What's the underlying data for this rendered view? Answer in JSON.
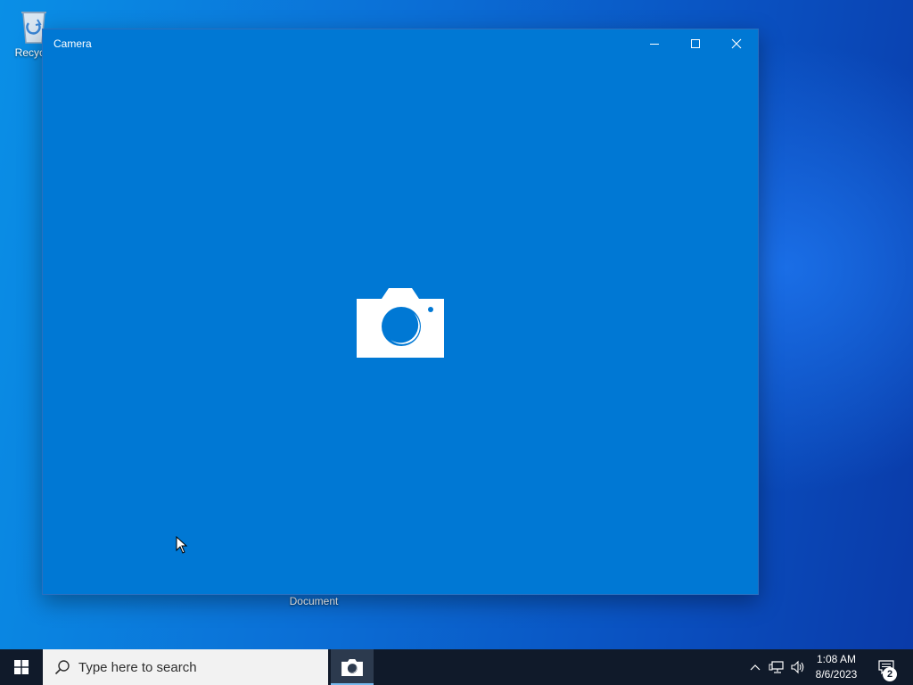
{
  "desktop": {
    "icons": [
      {
        "label": "Recycle",
        "icon": "recycle-bin-icon"
      },
      {
        "label": "Document",
        "icon": "document-icon"
      }
    ]
  },
  "window": {
    "title": "Camera",
    "controls": {
      "minimize": "minimize-icon",
      "maximize": "maximize-icon",
      "close": "close-icon"
    },
    "center_icon": "camera-icon",
    "background": "#0078d4"
  },
  "taskbar": {
    "search_placeholder": "Type here to search",
    "pinned_app": "camera-icon",
    "tray": {
      "time": "1:08 AM",
      "date": "8/6/2023",
      "notification_count": "2"
    }
  }
}
